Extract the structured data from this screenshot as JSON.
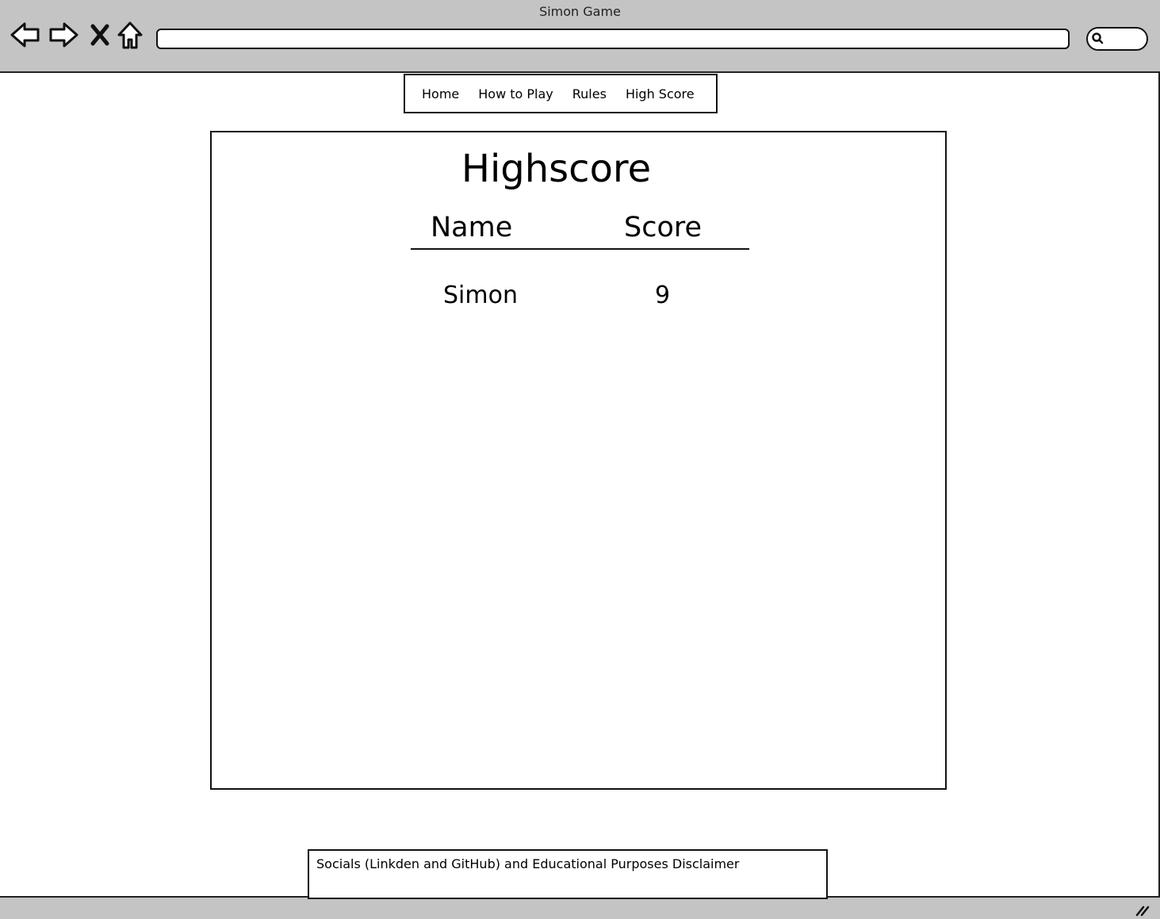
{
  "window": {
    "title": "Simon Game",
    "address": "",
    "icons": [
      "back-arrow-icon",
      "forward-arrow-icon",
      "stop-icon",
      "home-icon",
      "search-icon",
      "resize-grip-icon"
    ]
  },
  "menu": {
    "items": [
      {
        "label": "Home"
      },
      {
        "label": "How to Play"
      },
      {
        "label": "Rules"
      },
      {
        "label": "High Score"
      }
    ]
  },
  "highscore": {
    "title": "Highscore",
    "columns": {
      "name": "Name",
      "score": "Score"
    },
    "rows": [
      {
        "name": "Simon",
        "score": "9"
      }
    ]
  },
  "footer": {
    "text": "Socials (Linkden and GitHub) and Educational Purposes Disclaimer"
  },
  "colors": {
    "chrome": "#c4c4c4",
    "border": "#111111",
    "background": "#ffffff"
  }
}
